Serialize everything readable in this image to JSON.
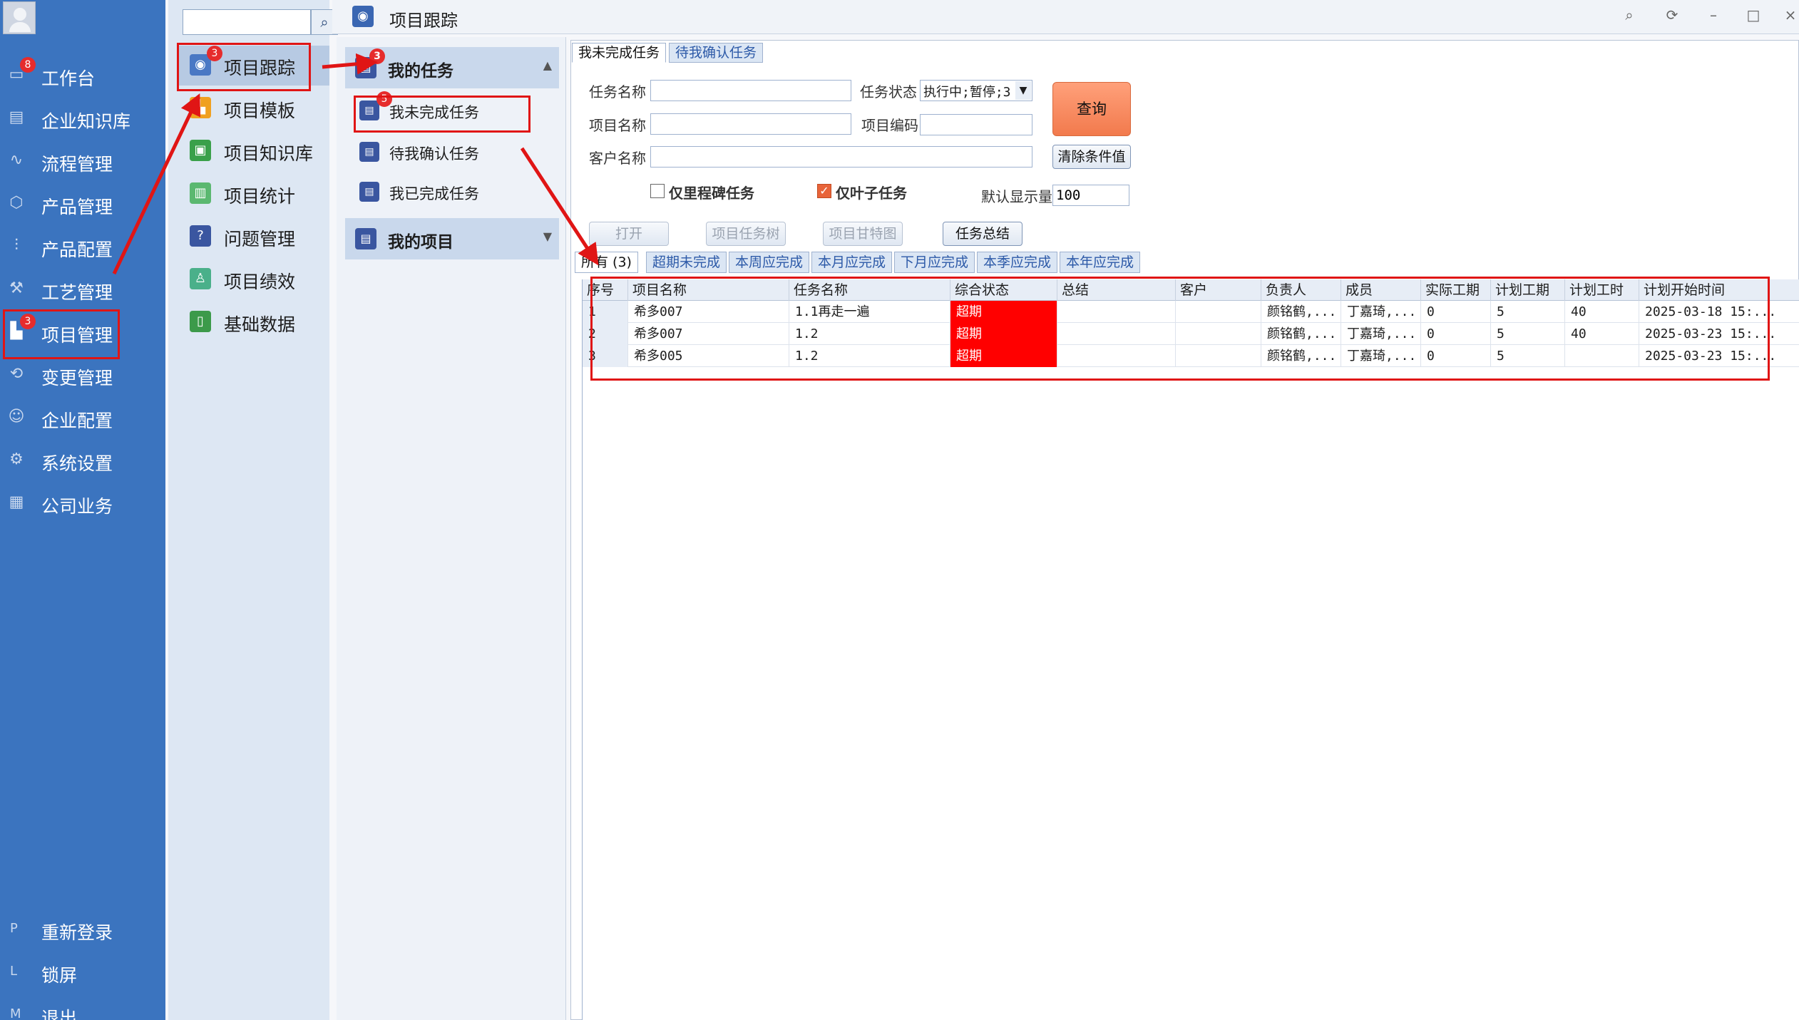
{
  "sidebar": {
    "items": [
      {
        "label": "工作台",
        "badge": "8",
        "icon": "monitor-icon"
      },
      {
        "label": "企业知识库",
        "icon": "book-icon"
      },
      {
        "label": "流程管理",
        "icon": "flow-icon"
      },
      {
        "label": "产品管理",
        "icon": "cube-icon"
      },
      {
        "label": "产品配置",
        "icon": "sliders-icon"
      },
      {
        "label": "工艺管理",
        "icon": "wrench-icon"
      },
      {
        "label": "项目管理",
        "badge": "3",
        "icon": "chart-icon"
      },
      {
        "label": "变更管理",
        "icon": "change-icon"
      },
      {
        "label": "企业配置",
        "icon": "users-icon"
      },
      {
        "label": "系统设置",
        "icon": "gear-icon"
      },
      {
        "label": "公司业务",
        "icon": "grid-icon"
      }
    ],
    "bottom": [
      {
        "key": "P",
        "label": "重新登录"
      },
      {
        "key": "L",
        "label": "锁屏"
      },
      {
        "key": "M",
        "label": "退出"
      }
    ]
  },
  "module_menu": {
    "search_placeholder": "",
    "items": [
      {
        "label": "项目跟踪",
        "badge": "3",
        "color": "#4a78c4"
      },
      {
        "label": "项目模板",
        "color": "#f0a020"
      },
      {
        "label": "项目知识库",
        "color": "#3aa04a"
      },
      {
        "label": "项目统计",
        "color": "#5bb870"
      },
      {
        "label": "问题管理",
        "color": "#3a56a0"
      },
      {
        "label": "项目绩效",
        "color": "#4ab08a"
      },
      {
        "label": "基础数据",
        "color": "#3c9a4a"
      }
    ]
  },
  "window": {
    "title": "项目跟踪"
  },
  "task_panel": {
    "groups": [
      {
        "label": "我的任务",
        "badge": "3"
      },
      {
        "label": "我的项目"
      }
    ],
    "subitems": [
      {
        "label": "我未完成任务",
        "badge": "5"
      },
      {
        "label": "待我确认任务"
      },
      {
        "label": "我已完成任务"
      }
    ]
  },
  "main": {
    "tabs": [
      "我未完成任务",
      "待我确认任务"
    ],
    "filters": {
      "task_name_label": "任务名称",
      "task_status_label": "任务状态",
      "task_status_value": "执行中;暂停;3",
      "project_name_label": "项目名称",
      "project_code_label": "项目编码",
      "customer_name_label": "客户名称",
      "milestone_label": "仅里程碑任务",
      "leaf_label": "仅叶子任务",
      "default_count_label": "默认显示量",
      "default_count_value": "100"
    },
    "buttons": {
      "query": "查询",
      "clear": "清除条件值",
      "open": "打开",
      "task_tree": "项目任务树",
      "gantt": "项目甘特图",
      "summary": "任务总结"
    },
    "subtabs": [
      "所有 (3)",
      "超期未完成",
      "本周应完成",
      "本月应完成",
      "下月应完成",
      "本季应完成",
      "本年应完成"
    ],
    "table": {
      "columns": [
        "序号",
        "项目名称",
        "任务名称",
        "综合状态",
        "总结",
        "客户",
        "负责人",
        "成员",
        "实际工期",
        "计划工期",
        "计划工时",
        "计划开始时间"
      ],
      "rows": [
        [
          "1",
          "希多007",
          "1.1再走一遍",
          "超期",
          "",
          "",
          "颜铭鹤,...",
          "丁嘉琦,...",
          "0",
          "5",
          "40",
          "2025-03-18 15:..."
        ],
        [
          "2",
          "希多007",
          "1.2",
          "超期",
          "",
          "",
          "颜铭鹤,...",
          "丁嘉琦,...",
          "0",
          "5",
          "40",
          "2025-03-23 15:..."
        ],
        [
          "3",
          "希多005",
          "1.2",
          "超期",
          "",
          "",
          "颜铭鹤,...",
          "丁嘉琦,...",
          "0",
          "5",
          "",
          "2025-03-23 15:..."
        ]
      ]
    }
  },
  "colors": {
    "sidebar": "#3b74bf",
    "overdue": "#ff0000",
    "annotation": "#e01515",
    "query_button": "#f58a5f"
  }
}
